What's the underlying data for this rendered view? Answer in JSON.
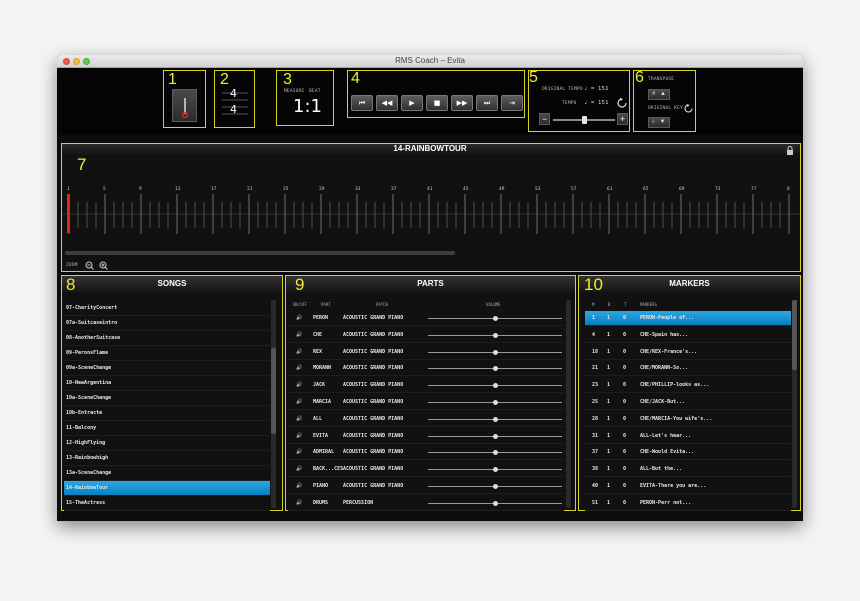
{
  "window": {
    "title": "RMS Coach – Evita"
  },
  "toolbar": {
    "box_numbers": [
      "1",
      "2",
      "3",
      "4",
      "5",
      "6"
    ],
    "time_sig": {
      "top": "4",
      "bottom": "4"
    },
    "position": {
      "measure_label": "MEASURE",
      "beat_label": "BEAT",
      "value": "1:1"
    },
    "transport": [
      "⏮",
      "◀◀",
      "▶",
      "■",
      "▶▶",
      "⏭",
      "⇥"
    ],
    "tempo": {
      "original_label": "ORIGINAL TEMPO",
      "original_value": "♩ = 151",
      "tempo_label": "TEMPO",
      "tempo_value": "♩ = 151",
      "minus": "−",
      "plus": "+",
      "level": 0.5
    },
    "transpose": {
      "label": "TRANSPOSE",
      "sharp": "#",
      "up": "▲",
      "original_key_label": "ORIGINAL KEY",
      "flat": "♭",
      "down": "▼"
    }
  },
  "timeline": {
    "number": "7",
    "song_title": "14-RAINBOWTOUR",
    "ticks": [
      "1",
      "5",
      "9",
      "13",
      "17",
      "21",
      "25",
      "29",
      "33",
      "37",
      "41",
      "45",
      "49",
      "53",
      "57",
      "61",
      "65",
      "69",
      "73",
      "77",
      "8"
    ],
    "zoom_label": "ZOOM"
  },
  "songs": {
    "number": "8",
    "title": "SONGS",
    "items": [
      "07-CharityConcert",
      "07a-Suitcaseintro",
      "08-AnotherSuitcase",
      "09-PeronsFlame",
      "09a-SceneChange",
      "10-NewArgentina",
      "10a-SceneChange",
      "10b-Entracte",
      "11-Balcony",
      "12-HighFlying",
      "13-Rainbowhigh",
      "13a-SceneChange",
      "14-RainbowTour",
      "15-TheActress"
    ],
    "selected_index": 12
  },
  "parts": {
    "number": "9",
    "title": "PARTS",
    "headers": {
      "onoff": "ON/OFF",
      "part": "PART",
      "patch": "PATCH",
      "volume": "VOLUME"
    },
    "rows": [
      {
        "part": "PERON",
        "patch": "ACOUSTIC GRAND PIANO",
        "volume": 0.5
      },
      {
        "part": "CHE",
        "patch": "ACOUSTIC GRAND PIANO",
        "volume": 0.5
      },
      {
        "part": "REX",
        "patch": "ACOUSTIC GRAND PIANO",
        "volume": 0.5
      },
      {
        "part": "MORANN",
        "patch": "ACOUSTIC GRAND PIANO",
        "volume": 0.5
      },
      {
        "part": "JACK",
        "patch": "ACOUSTIC GRAND PIANO",
        "volume": 0.5
      },
      {
        "part": "MARCIA",
        "patch": "ACOUSTIC GRAND PIANO",
        "volume": 0.5
      },
      {
        "part": "ALL",
        "patch": "ACOUSTIC GRAND PIANO",
        "volume": 0.5
      },
      {
        "part": "EVITA",
        "patch": "ACOUSTIC GRAND PIANO",
        "volume": 0.5
      },
      {
        "part": "ADMIRAL",
        "patch": "ACOUSTIC GRAND PIANO",
        "volume": 0.5
      },
      {
        "part": "BACK...CES",
        "patch": "ACOUSTIC GRAND PIANO",
        "volume": 0.5
      },
      {
        "part": "PIANO",
        "patch": "ACOUSTIC GRAND PIANO",
        "volume": 0.5
      },
      {
        "part": "DRUMS",
        "patch": "PERCUSSION",
        "volume": 0.5
      }
    ]
  },
  "markers": {
    "number": "10",
    "title": "MARKERS",
    "headers": {
      "m": "M",
      "b": "B",
      "t": "T",
      "markers": "MARKERS"
    },
    "rows": [
      {
        "m": "1",
        "b": "1",
        "t": "0",
        "text": "PERON-People of..."
      },
      {
        "m": "4",
        "b": "1",
        "t": "0",
        "text": "CHE-Spain has..."
      },
      {
        "m": "18",
        "b": "1",
        "t": "0",
        "text": "CHE/REX-France's..."
      },
      {
        "m": "21",
        "b": "1",
        "t": "0",
        "text": "CHE/MORANN-So..."
      },
      {
        "m": "23",
        "b": "1",
        "t": "0",
        "text": "CHE/PHILLIP-looks as..."
      },
      {
        "m": "25",
        "b": "1",
        "t": "0",
        "text": "CHE/JACK-But..."
      },
      {
        "m": "28",
        "b": "1",
        "t": "0",
        "text": "CHE/MARCIA-You wife's..."
      },
      {
        "m": "31",
        "b": "1",
        "t": "0",
        "text": "ALL-Let's hear..."
      },
      {
        "m": "37",
        "b": "1",
        "t": "0",
        "text": "CHE-Would Evita..."
      },
      {
        "m": "38",
        "b": "1",
        "t": "0",
        "text": "ALL-But the..."
      },
      {
        "m": "40",
        "b": "1",
        "t": "0",
        "text": "EVITA-There you are..."
      },
      {
        "m": "51",
        "b": "1",
        "t": "0",
        "text": "PERON-Perr not..."
      }
    ],
    "selected_index": 0
  },
  "colors": {
    "accent_yellow": "#d6d41f",
    "selection_blue": "#1b95d8",
    "playhead": "#e0281d"
  }
}
